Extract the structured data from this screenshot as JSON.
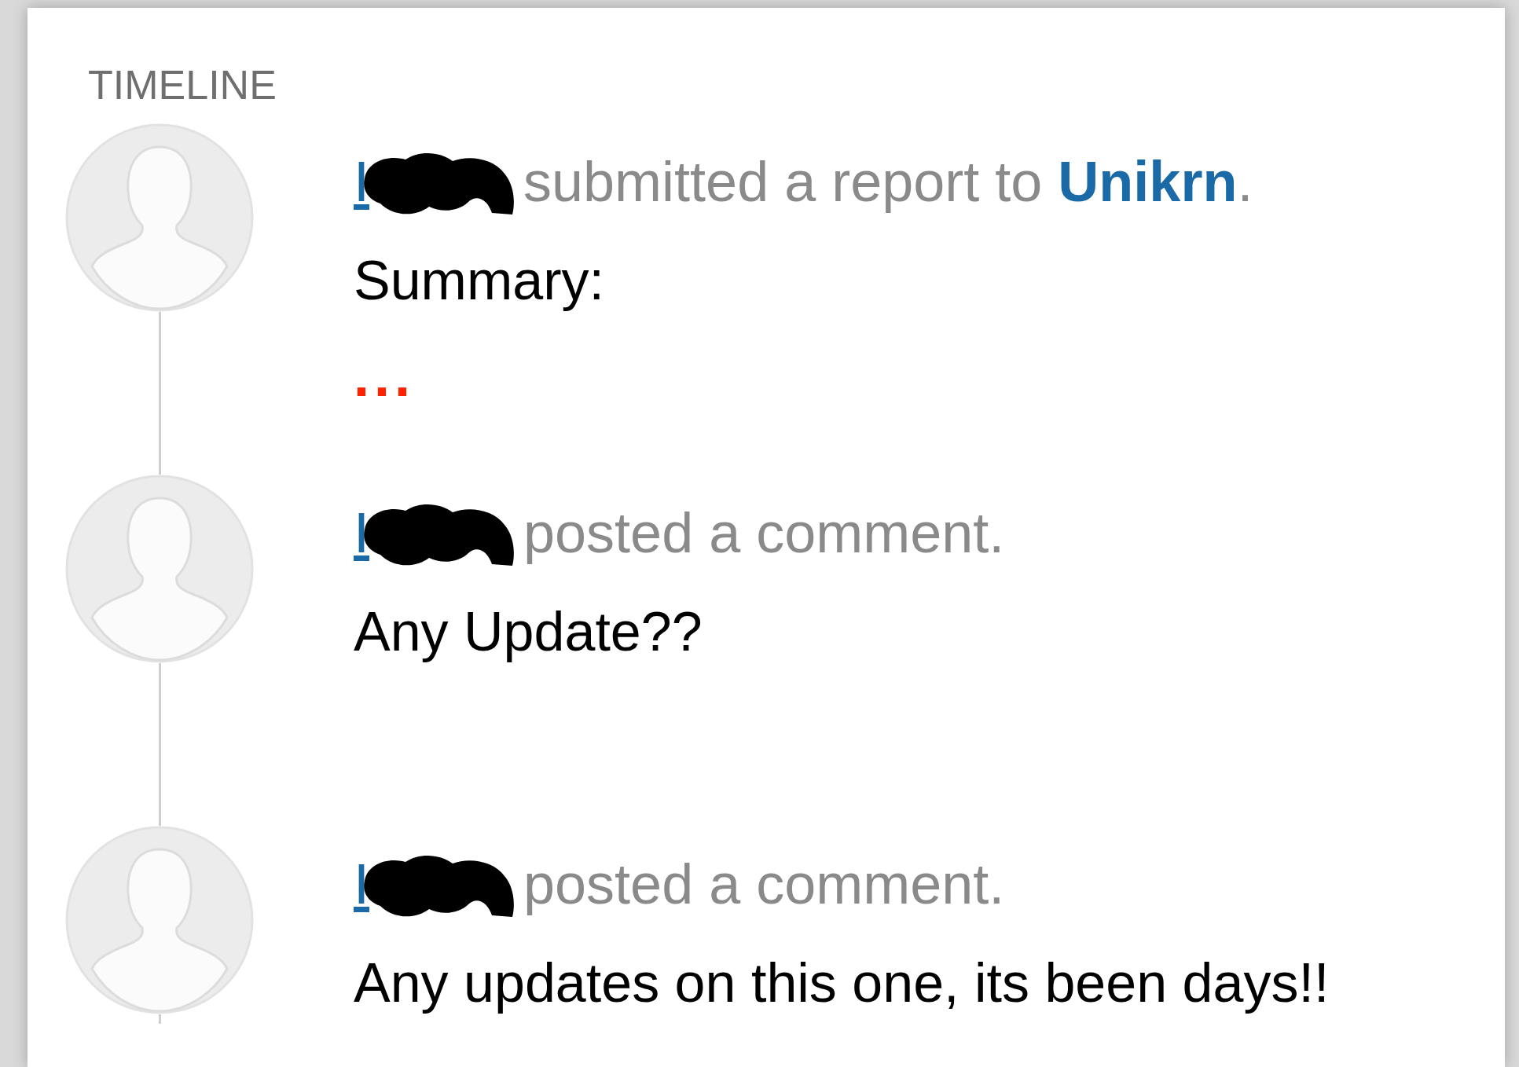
{
  "section_title": "TIMELINE",
  "events": [
    {
      "actor": "I",
      "action": "submitted a report to ",
      "target": "Unikrn",
      "suffix": ".",
      "body": [
        {
          "kind": "text",
          "text": "Summary:"
        },
        {
          "kind": "ellipsis",
          "text": "..."
        }
      ]
    },
    {
      "actor": "I",
      "action": "posted a comment.",
      "body": [
        {
          "kind": "text",
          "text": "Any Update??"
        }
      ]
    },
    {
      "actor": "I",
      "action": "posted a comment.",
      "body": [
        {
          "kind": "text",
          "text": "Any updates on this one, its been days!!"
        }
      ]
    }
  ]
}
